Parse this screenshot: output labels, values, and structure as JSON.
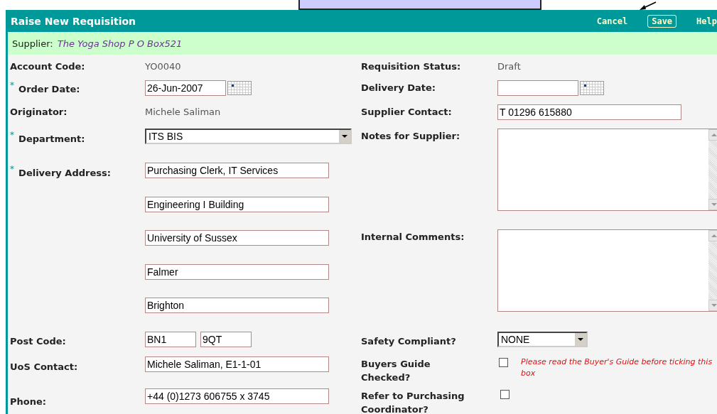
{
  "header": {
    "title": "Raise New Requisition",
    "actions": [
      {
        "label": "Cancel",
        "kind": "link"
      },
      {
        "label": "Save",
        "kind": "button"
      },
      {
        "label": "Help",
        "kind": "link"
      }
    ]
  },
  "supplier": {
    "label": "Supplier:",
    "value": "The Yoga Shop P O Box521"
  },
  "left_fields": [
    {
      "label": "Account Code:",
      "kind": "readonly",
      "value": "YO0040"
    },
    {
      "label": "Order Date:",
      "required_mark": "*",
      "kind": "date",
      "value": "26-Jun-2007"
    },
    {
      "label": "Originator:",
      "kind": "readonly",
      "value": "Michele Saliman"
    },
    {
      "label": "Department:",
      "required_mark": "*",
      "kind": "select",
      "value": "ITS BIS"
    },
    {
      "label": "Delivery Address:",
      "required_mark": "*",
      "kind": "lines",
      "values": [
        "Purchasing Clerk, IT Services",
        "Engineering I Building",
        "University of Sussex",
        "Falmer",
        "Brighton"
      ]
    },
    {
      "label": "Post Code:",
      "kind": "pair",
      "values": [
        "BN1",
        "9QT"
      ]
    },
    {
      "label": "UoS Contact:",
      "kind": "input",
      "value": "Michele Saliman, E1-1-01"
    },
    {
      "label": "Phone:",
      "kind": "input",
      "value": "+44 (0)1273 606755 x 3745"
    }
  ],
  "right_fields": [
    {
      "label": "Requisition Status:",
      "kind": "readonly",
      "value": "Draft"
    },
    {
      "label": "Delivery Date:",
      "kind": "date"
    },
    {
      "label": "Supplier Contact:",
      "kind": "input",
      "value": "T 01296 615880"
    },
    {
      "label": "Notes for Supplier:",
      "kind": "textarea"
    },
    {
      "label": "Internal Comments:",
      "kind": "textarea"
    },
    {
      "label": "Safety Compliant?",
      "kind": "select",
      "value": "NONE"
    },
    {
      "label": "Buyers Guide Checked?",
      "kind": "checkbox",
      "checked": false,
      "note": "Please read the Buyer's Guide before ticking this box"
    },
    {
      "label": "Refer to Purchasing Coordinator?",
      "kind": "checkbox",
      "checked": false
    }
  ]
}
